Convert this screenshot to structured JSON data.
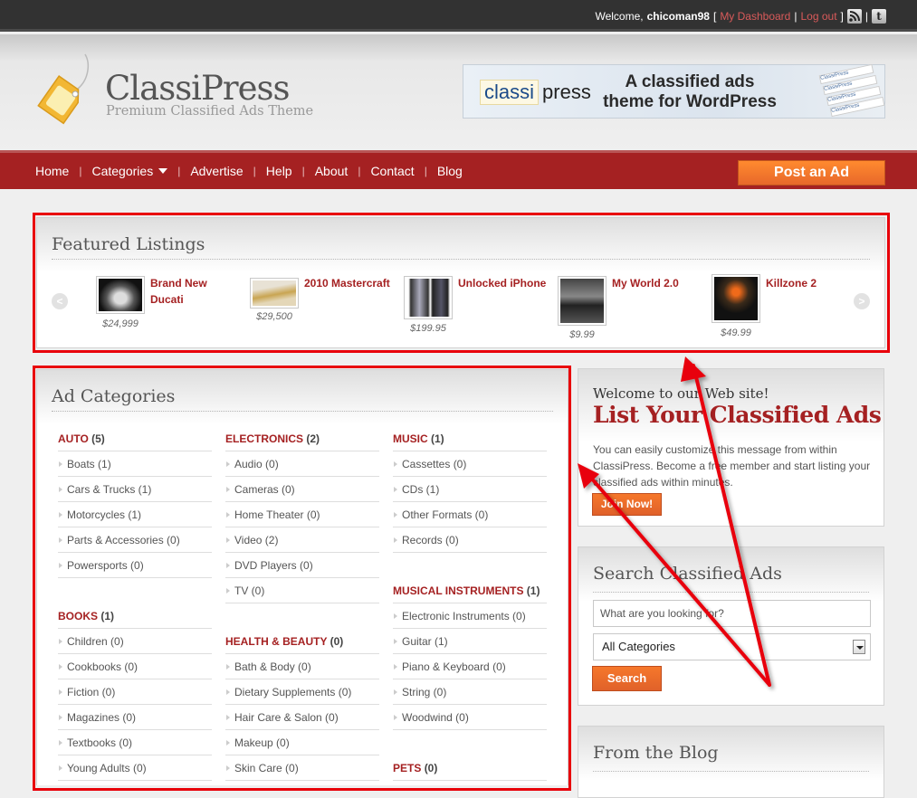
{
  "topbar": {
    "welcome_prefix": "Welcome,",
    "username": "chicoman98",
    "open_bracket": "[",
    "dashboard_link": "My Dashboard",
    "separator": "|",
    "logout_link": "Log out",
    "close_bracket": "]",
    "icons": [
      "rss-icon",
      "twitter-icon"
    ],
    "twitter_glyph": "t"
  },
  "header": {
    "logo_title": "ClassiPress",
    "logo_tagline": "Premium Classified Ads Theme",
    "banner": {
      "brand_part1": "classi",
      "brand_part2": "press",
      "slogan": "A classified ads theme for WordPress",
      "shot_label": "ClassiPress"
    }
  },
  "nav": {
    "items": [
      "Home",
      "Categories",
      "Advertise",
      "Help",
      "About",
      "Contact",
      "Blog"
    ],
    "divider": "|",
    "post_ad_label": "Post an Ad"
  },
  "featured": {
    "title": "Featured Listings",
    "prev_glyph": "<",
    "next_glyph": ">",
    "items": [
      {
        "title": "Brand New Ducati",
        "price": "$24,999"
      },
      {
        "title": "2010 Mastercraft",
        "price": "$29,500"
      },
      {
        "title": "Unlocked iPhone",
        "price": "$199.95"
      },
      {
        "title": "My World 2.0",
        "price": "$9.99"
      },
      {
        "title": "Killzone 2",
        "price": "$49.99"
      }
    ]
  },
  "categories": {
    "title": "Ad Categories",
    "columns": [
      [
        {
          "name": "AUTO",
          "count": "(5)",
          "subs": [
            "Boats (1)",
            "Cars & Trucks (1)",
            "Motorcycles (1)",
            "Parts & Accessories (0)",
            "Powersports (0)"
          ]
        },
        {
          "name": "BOOKS",
          "count": "(1)",
          "subs": [
            "Children (0)",
            "Cookbooks (0)",
            "Fiction (0)",
            "Magazines (0)",
            "Textbooks (0)",
            "Young Adults (0)"
          ]
        }
      ],
      [
        {
          "name": "ELECTRONICS",
          "count": "(2)",
          "subs": [
            "Audio (0)",
            "Cameras (0)",
            "Home Theater (0)",
            "Video (2)",
            "DVD Players (0)",
            "TV (0)"
          ]
        },
        {
          "name": "HEALTH & BEAUTY",
          "count": "(0)",
          "subs": [
            "Bath & Body (0)",
            "Dietary Supplements (0)",
            "Hair Care & Salon (0)",
            "Makeup (0)",
            "Skin Care (0)"
          ]
        }
      ],
      [
        {
          "name": "MUSIC",
          "count": "(1)",
          "subs": [
            "Cassettes (0)",
            "CDs (1)",
            "Other Formats (0)",
            "Records (0)"
          ]
        },
        {
          "name": "MUSICAL INSTRUMENTS",
          "count": "(1)",
          "subs": [
            "Electronic Instruments (0)",
            "Guitar (1)",
            "Piano & Keyboard (0)",
            "String (0)",
            "Woodwind (0)"
          ]
        },
        {
          "name": "PETS",
          "count": "(0)",
          "subs": []
        }
      ]
    ]
  },
  "welcome": {
    "line1": "Welcome to our Web site!",
    "headline": "List Your Classified Ads",
    "body": "You can easily customize this message from within ClassiPress. Become a free member and start listing your classified ads within minutes.",
    "button": "Join Now!"
  },
  "search": {
    "title": "Search Classified Ads",
    "placeholder": "What are you looking for?",
    "select_value": "All Categories",
    "button": "Search"
  },
  "blog": {
    "title": "From the Blog"
  },
  "colors": {
    "brand_red": "#a52122",
    "accent_orange": "#f0702a",
    "topbar_bg": "#323232",
    "annotation_red": "#e8000a"
  }
}
